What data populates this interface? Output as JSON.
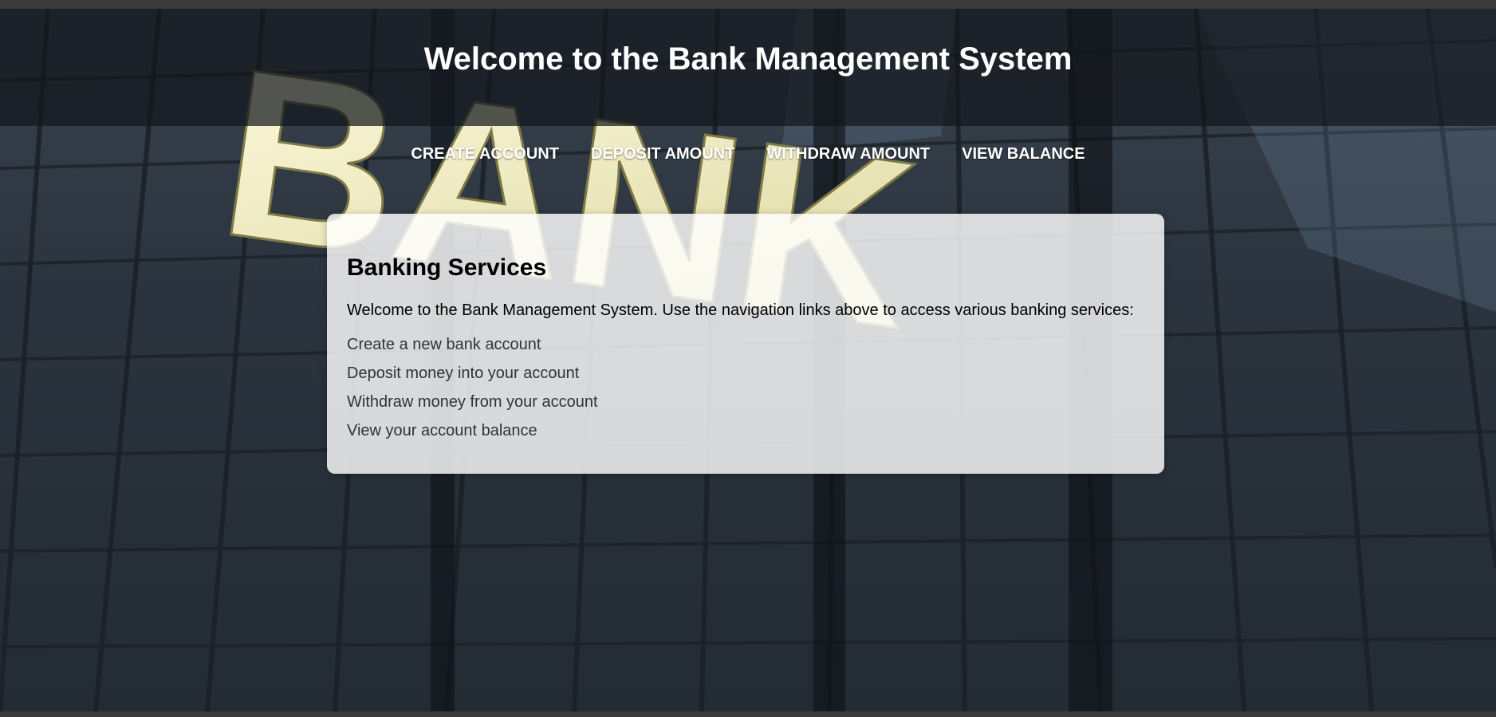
{
  "header": {
    "title": "Welcome to the Bank Management System"
  },
  "nav": {
    "items": [
      {
        "label": "CREATE ACCOUNT"
      },
      {
        "label": "DEPOSIT AMOUNT"
      },
      {
        "label": "WITHDRAW AMOUNT"
      },
      {
        "label": "VIEW BALANCE"
      }
    ]
  },
  "card": {
    "heading": "Banking Services",
    "intro": "Welcome to the Bank Management System. Use the navigation links above to access various banking services:",
    "services": [
      "Create a new bank account",
      "Deposit money into your account",
      "Withdraw money from your account",
      "View your account balance"
    ]
  },
  "background": {
    "image_text": "BANK",
    "colors": {
      "sky": "#39434e",
      "letters": "#f2f0c8",
      "frame": "#1a2027"
    }
  }
}
